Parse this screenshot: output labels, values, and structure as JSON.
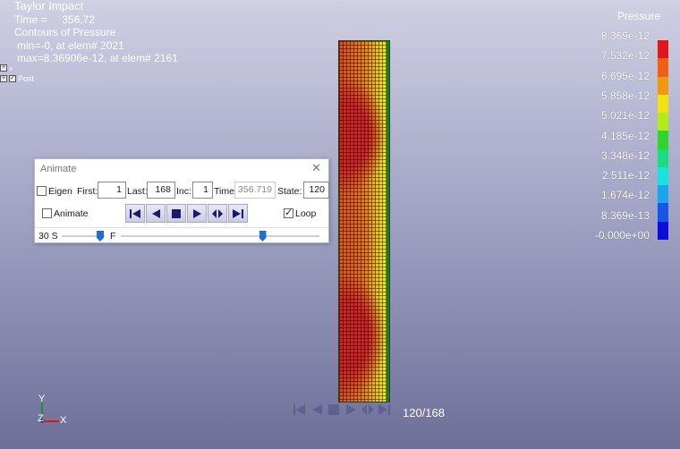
{
  "info": {
    "title": "Taylor Impact",
    "time_line": "Time =     356.72",
    "contours_line": "Contours of Pressure",
    "min_line": "min=-0, at elem# 2021",
    "max_line": "max=8.36906e-12, at elem# 2161"
  },
  "tree": {
    "item_label": "Post"
  },
  "legend": {
    "title": "Pressure",
    "labels": [
      "8.369e-12",
      "7.532e-12",
      "6.695e-12",
      "5.858e-12",
      "5.021e-12",
      "4.185e-12",
      "3.348e-12",
      "2.511e-12",
      "1.674e-12",
      "8.369e-13",
      "-0.000e+00"
    ],
    "colors": [
      "#e3151a",
      "#f06010",
      "#ef9a0d",
      "#f2e20f",
      "#b6ea16",
      "#2fd629",
      "#16e07d",
      "#16e4df",
      "#1aa6ef",
      "#1658e6",
      "#0c0ce0"
    ]
  },
  "animate": {
    "title": "Animate",
    "eigen_label": "Eigen",
    "eigen_checked": false,
    "first_label": "First:",
    "first_value": "1",
    "last_label": "Last:",
    "last_value": "168",
    "inc_label": "Inc:",
    "inc_value": "1",
    "time_label": "Time:",
    "time_value": "356.719",
    "state_label": "State:",
    "state_value": "120",
    "animate_label": "Animate",
    "animate_checked": false,
    "loop_label": "Loop",
    "loop_checked": true,
    "speed_slow_label": "30 S",
    "speed_fast_label": "F",
    "state_progress": 0.714
  },
  "bottom": {
    "frame_counter": "120/168"
  },
  "axis": {
    "y_label": "Y",
    "z_label": "Z",
    "x_label": "X"
  },
  "icons": {
    "transport": [
      "skip-to-first-icon",
      "step-back-icon",
      "stop-icon",
      "play-icon",
      "step-forward-icon",
      "skip-to-last-icon"
    ]
  }
}
